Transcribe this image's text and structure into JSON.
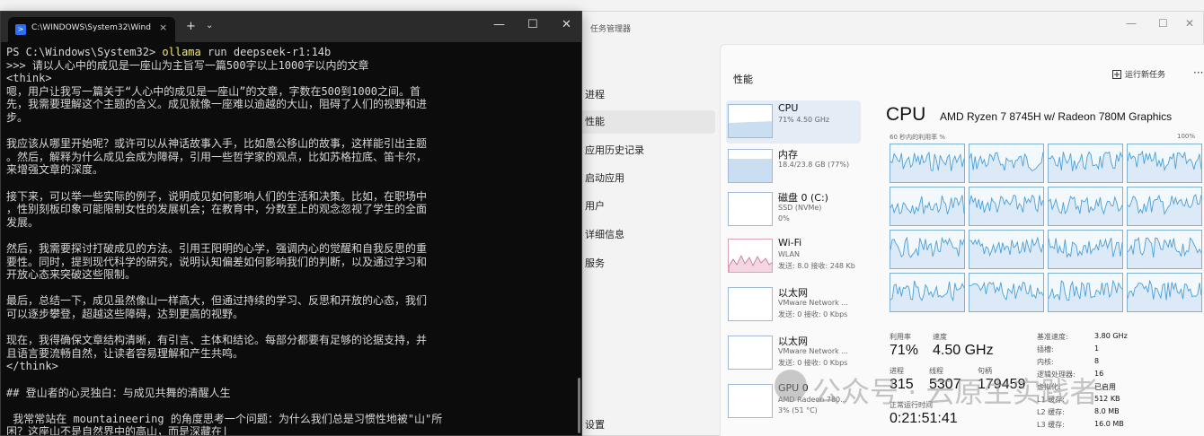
{
  "terminal": {
    "tab_title": "C:\\WINDOWS\\System32\\Wind",
    "tab_close": "×",
    "new_tab": "+",
    "dropdown": "⌄",
    "minimize": "—",
    "maximize": "☐",
    "close": "✕",
    "prompt": "PS C:\\Windows\\System32> ",
    "command": "ollama",
    "command_args": " run deepseek-r1:14b",
    "lines": [
      ">>> 请以人心中的成见是一座山为主旨写一篇500字以上1000字以内的文章",
      "<think>",
      "嗯，用户让我写一篇关于“人心中的成见是一座山”的文章，字数在500到1000之间。首",
      "先，我需要理解这个主题的含义。成见就像一座难以逾越的大山，阻碍了人们的视野和进",
      "步。",
      "",
      "我应该从哪里开始呢？或许可以从神话故事入手，比如愚公移山的故事，这样能引出主题",
      "。然后，解释为什么成见会成为障碍，引用一些哲学家的观点，比如苏格拉底、笛卡尔，",
      "来增强文章的深度。",
      "",
      "接下来，可以举一些实际的例子，说明成见如何影响人们的生活和决策。比如，在职场中",
      "，性别刻板印象可能限制女性的发展机会；在教育中，分数至上的观念忽视了学生的全面",
      "发展。",
      "",
      "然后，我需要探讨打破成见的方法。引用王阳明的心学，强调内心的觉醒和自我反思的重",
      "要性。同时，提到现代科学的研究，说明认知偏差如何影响我们的判断，以及通过学习和",
      "开放心态来突破这些限制。",
      "",
      "最后，总结一下，成见虽然像山一样高大，但通过持续的学习、反思和开放的心态，我们",
      "可以逐步攀登，超越这些障碍，达到更高的视野。",
      "",
      "现在，我得确保文章结构清晰，有引言、主体和结论。每部分都要有足够的论据支持，并",
      "且语言要流畅自然，让读者容易理解和产生共鸣。",
      "</think>",
      "",
      "## 登山者的心灵独白：与成见共舞的清醒人生",
      "",
      " 我常常站在 mountaineering 的角度思考一个问题：为什么我们总是习惯性地被\"山\"所",
      "困？这座山不是自然界中的高山，而是深藏在|"
    ]
  },
  "taskmgr": {
    "title": "任务管理器",
    "min": "—",
    "max": "☐",
    "close": "✕",
    "nav": [
      "进程",
      "性能",
      "应用历史记录",
      "启动应用",
      "用户",
      "详细信息",
      "服务"
    ],
    "settings": "设置",
    "section": "性能",
    "run_task": "运行新任务",
    "more": "···",
    "resources": [
      {
        "name": "CPU",
        "sub1": "71% 4.50 GHz",
        "sub2": ""
      },
      {
        "name": "内存",
        "sub1": "18.4/23.8 GB (77%)",
        "sub2": ""
      },
      {
        "name": "磁盘 0 (C:)",
        "sub1": "SSD (NVMe)",
        "sub2": "0%"
      },
      {
        "name": "Wi-Fi",
        "sub1": "WLAN",
        "sub2": "发送: 8.0 接收: 248 Kb"
      },
      {
        "name": "以太网",
        "sub1": "VMware Network ...",
        "sub2": "发送: 0 接收: 0 Kbps"
      },
      {
        "name": "以太网",
        "sub1": "VMware Network ...",
        "sub2": "发送: 0 接收: 0 Kbps"
      },
      {
        "name": "GPU 0",
        "sub1": "AMD Radeon 780...",
        "sub2": "3% (51 °C)"
      }
    ],
    "cpu_heading": "CPU",
    "cpu_model": "AMD Ryzen 7 8745H w/ Radeon 780M Graphics",
    "graph_caption": "60 秒内的利用率 %",
    "graph_max": "100%",
    "stats": {
      "util_label": "利用率",
      "util_value": "71%",
      "speed_label": "速度",
      "speed_value": "4.50 GHz",
      "proc_label": "进程",
      "proc_value": "315",
      "thread_label": "线程",
      "thread_value": "5307",
      "handle_label": "句柄",
      "handle_value": "179459",
      "uptime_label": "正常运行时间",
      "uptime_value": "0:21:51:41"
    },
    "specs": [
      {
        "k": "基准速度:",
        "v": "3.80 GHz"
      },
      {
        "k": "插槽:",
        "v": "1"
      },
      {
        "k": "内核:",
        "v": "8"
      },
      {
        "k": "逻辑处理器:",
        "v": "16"
      },
      {
        "k": "虚拟化:",
        "v": "已启用"
      },
      {
        "k": "L1 缓存:",
        "v": "512 KB"
      },
      {
        "k": "L2 缓存:",
        "v": "8.0 MB"
      },
      {
        "k": "L3 缓存:",
        "v": "16.0 MB"
      }
    ]
  },
  "watermark": "公众号 · 云原生实践者",
  "colors": {
    "terminal_bg": "#0c0c0c",
    "command_yellow": "#f5e96b",
    "graph_line": "#4a9fd8",
    "graph_fill": "#dbeaf6"
  }
}
